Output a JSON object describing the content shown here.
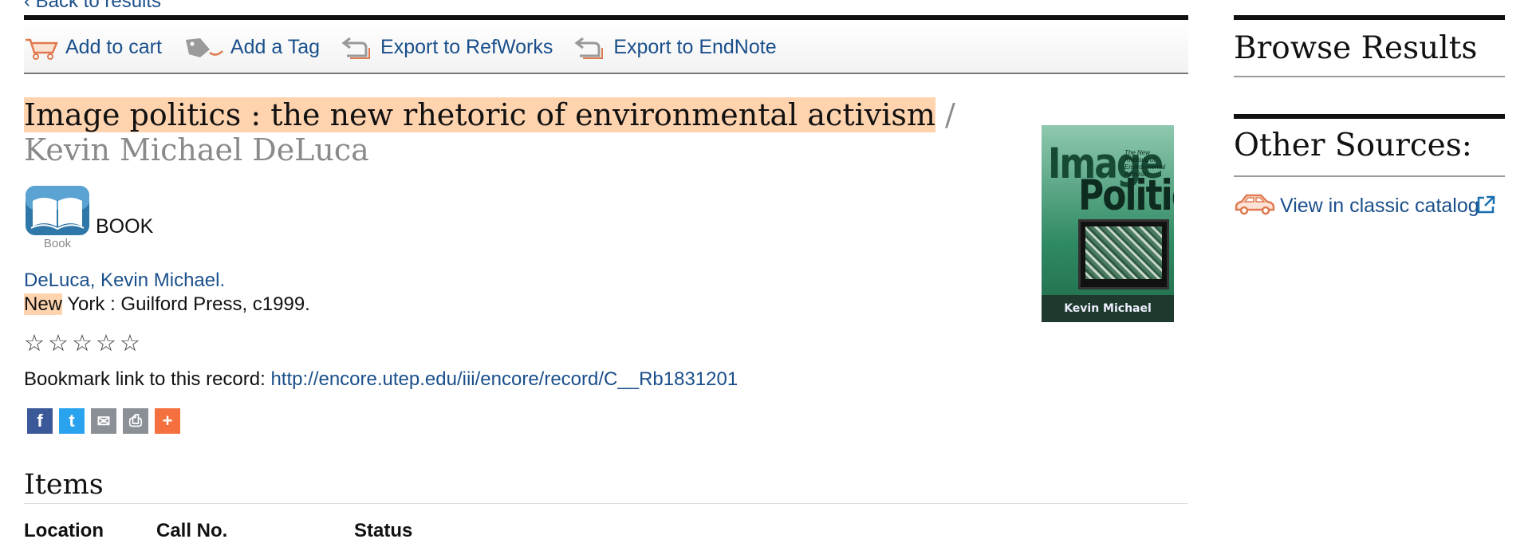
{
  "nav": {
    "back_label": "‹ Back to results"
  },
  "toolbar": {
    "add_to_cart": "Add to cart",
    "add_tag": "Add a Tag",
    "export_refworks": "Export to RefWorks",
    "export_endnote": "Export to EndNote"
  },
  "record": {
    "title": "Image politics : the new rhetoric of environmental activism",
    "author_suffix": " / Kevin Michael DeLuca",
    "format_icon_label": "Book",
    "format": "BOOK",
    "author_link": "DeLuca, Kevin Michael.",
    "pub_highlight": "New",
    "pub_rest": " York : Guilford Press, c1999.",
    "rating": {
      "filled": 0,
      "max": 5
    },
    "bookmark_label": "Bookmark link to this record: ",
    "bookmark_url": "http://encore.utep.edu/iii/encore/record/C__Rb1831201"
  },
  "cover": {
    "title_line1": "Image",
    "title_line2": "Politics",
    "subtitle": "The New Rhetoric of Environmental Activism",
    "author": "Kevin Michael DeLuca"
  },
  "share": [
    {
      "name": "facebook",
      "glyph": "f",
      "color": "#3b5998"
    },
    {
      "name": "twitter",
      "glyph": "t",
      "color": "#2aa3ef"
    },
    {
      "name": "email",
      "glyph": "✉",
      "color": "#8a9096"
    },
    {
      "name": "print",
      "glyph": "⎙",
      "color": "#8a9096"
    },
    {
      "name": "more",
      "glyph": "+",
      "color": "#f4713f"
    }
  ],
  "items": {
    "heading": "Items",
    "columns": [
      "Location",
      "Call No.",
      "Status"
    ]
  },
  "sidebar": {
    "browse_heading": "Browse Results",
    "sources_heading": "Other Sources:",
    "classic_link": "View in classic catalog"
  },
  "colors": {
    "link": "#1a4f8b",
    "highlight": "#ffd3ae"
  }
}
